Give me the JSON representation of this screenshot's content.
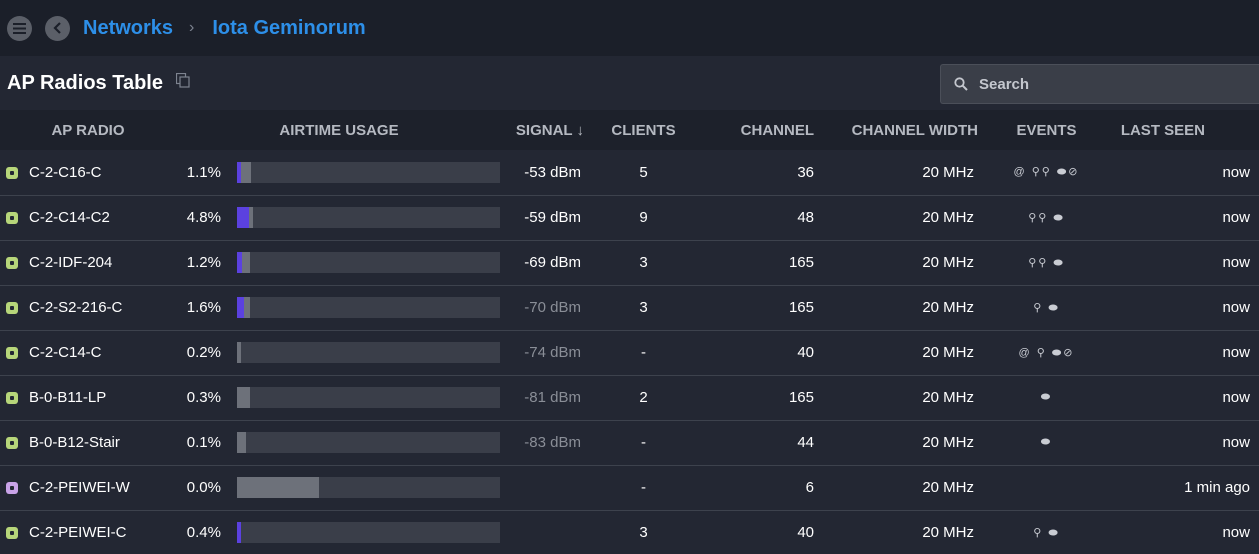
{
  "breadcrumb": {
    "root": "Networks",
    "separator": "›",
    "current": "Iota Geminorum"
  },
  "section": {
    "title": "AP Radios Table"
  },
  "search": {
    "placeholder": "Search"
  },
  "columns": [
    "AP RADIO",
    "AIRTIME USAGE",
    "SIGNAL ↓",
    "CLIENTS",
    "CHANNEL",
    "CHANNEL WIDTH",
    "EVENTS",
    "LAST SEEN"
  ],
  "colors": {
    "accent": "#2d8fe8",
    "status_green": "#b7d67a",
    "status_purple": "#c9a3e8",
    "airtime_active": "#5b41e0"
  },
  "rows": [
    {
      "name": "C-2-C16-C",
      "status": "green",
      "airtime": "1.1%",
      "airtime_total": 0.055,
      "airtime_active": 0.015,
      "signal": "-53 dBm",
      "signal_dim": false,
      "clients": "5",
      "channel": "36",
      "width": "20 MHz",
      "events": "@ ⚲⚲ ⬬⊘",
      "seen": "now"
    },
    {
      "name": "C-2-C14-C2",
      "status": "green",
      "airtime": "4.8%",
      "airtime_total": 0.06,
      "airtime_active": 0.045,
      "signal": "-59 dBm",
      "signal_dim": false,
      "clients": "9",
      "channel": "48",
      "width": "20 MHz",
      "events": "⚲⚲ ⬬",
      "seen": "now"
    },
    {
      "name": "C-2-IDF-204",
      "status": "green",
      "airtime": "1.2%",
      "airtime_total": 0.05,
      "airtime_active": 0.02,
      "signal": "-69 dBm",
      "signal_dim": false,
      "clients": "3",
      "channel": "165",
      "width": "20 MHz",
      "events": "⚲⚲ ⬬",
      "seen": "now"
    },
    {
      "name": "C-2-S2-216-C",
      "status": "green",
      "airtime": "1.6%",
      "airtime_total": 0.05,
      "airtime_active": 0.025,
      "signal": "-70 dBm",
      "signal_dim": true,
      "clients": "3",
      "channel": "165",
      "width": "20 MHz",
      "events": "⚲ ⬬",
      "seen": "now"
    },
    {
      "name": "C-2-C14-C",
      "status": "green",
      "airtime": "0.2%",
      "airtime_total": 0.015,
      "airtime_active": 0,
      "signal": "-74 dBm",
      "signal_dim": true,
      "clients": "-",
      "channel": "40",
      "width": "20 MHz",
      "events": "@ ⚲ ⬬⊘",
      "seen": "now"
    },
    {
      "name": "B-0-B11-LP",
      "status": "green",
      "airtime": "0.3%",
      "airtime_total": 0.05,
      "airtime_active": 0,
      "signal": "-81 dBm",
      "signal_dim": true,
      "clients": "2",
      "channel": "165",
      "width": "20 MHz",
      "events": "⬬",
      "seen": "now"
    },
    {
      "name": "B-0-B12-Stair",
      "status": "green",
      "airtime": "0.1%",
      "airtime_total": 0.035,
      "airtime_active": 0,
      "signal": "-83 dBm",
      "signal_dim": true,
      "clients": "-",
      "channel": "44",
      "width": "20 MHz",
      "events": "⬬",
      "seen": "now"
    },
    {
      "name": "C-2-PEIWEI-W",
      "status": "purple",
      "airtime": "0.0%",
      "airtime_total": 0.31,
      "airtime_active": 0,
      "signal": "",
      "signal_dim": true,
      "clients": "-",
      "channel": "6",
      "width": "20 MHz",
      "events": "",
      "seen": "1 min ago"
    },
    {
      "name": "C-2-PEIWEI-C",
      "status": "green",
      "airtime": "0.4%",
      "airtime_total": 0.015,
      "airtime_active": 0.015,
      "signal": "",
      "signal_dim": true,
      "clients": "3",
      "channel": "40",
      "width": "20 MHz",
      "events": "⚲ ⬬",
      "seen": "now"
    }
  ]
}
